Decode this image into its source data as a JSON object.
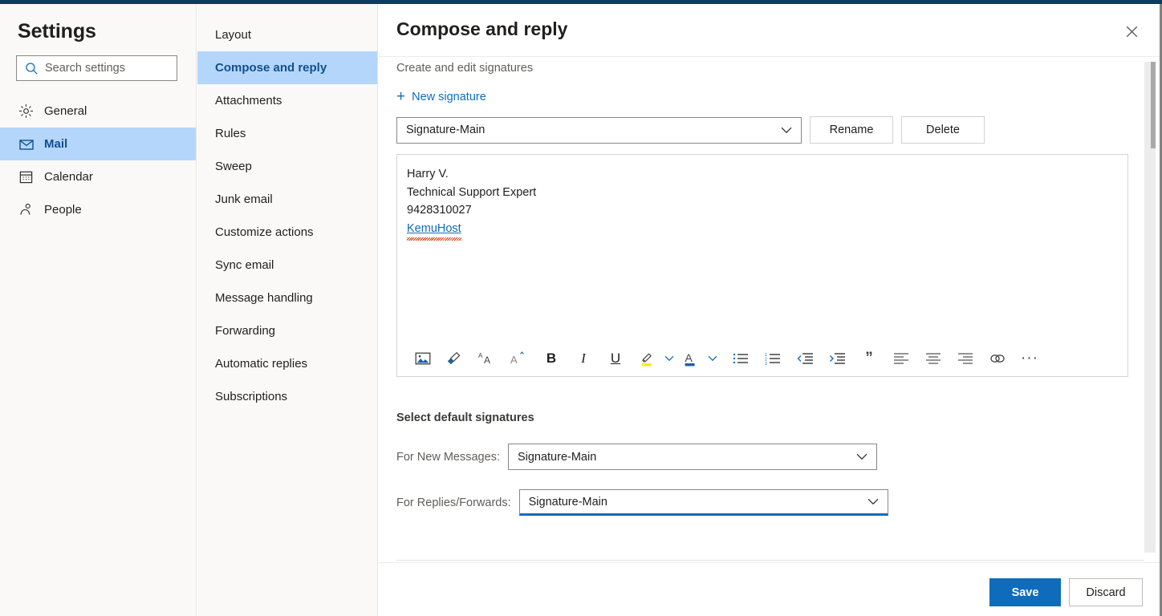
{
  "settings": {
    "title": "Settings",
    "search": {
      "placeholder": "Search settings",
      "value": "",
      "icon": "search-icon"
    },
    "categories": [
      {
        "label": "General",
        "icon": "gear-icon",
        "selected": false
      },
      {
        "label": "Mail",
        "icon": "envelope-icon",
        "selected": true
      },
      {
        "label": "Calendar",
        "icon": "calendar-icon",
        "selected": false
      },
      {
        "label": "People",
        "icon": "person-icon",
        "selected": false
      }
    ]
  },
  "subnav": {
    "items": [
      {
        "label": "Layout",
        "selected": false
      },
      {
        "label": "Compose and reply",
        "selected": true
      },
      {
        "label": "Attachments",
        "selected": false
      },
      {
        "label": "Rules",
        "selected": false
      },
      {
        "label": "Sweep",
        "selected": false
      },
      {
        "label": "Junk email",
        "selected": false
      },
      {
        "label": "Customize actions",
        "selected": false
      },
      {
        "label": "Sync email",
        "selected": false
      },
      {
        "label": "Message handling",
        "selected": false
      },
      {
        "label": "Forwarding",
        "selected": false
      },
      {
        "label": "Automatic replies",
        "selected": false
      },
      {
        "label": "Subscriptions",
        "selected": false
      }
    ]
  },
  "detail": {
    "title": "Compose and reply",
    "close_icon": "close-icon",
    "section_label": "Create and edit signatures",
    "new_signature_label": "New signature",
    "signature_select": {
      "value": "Signature-Main"
    },
    "rename_label": "Rename",
    "delete_label": "Delete",
    "signature_body": {
      "line1": "Harry V.",
      "line2": "Technical Support Expert",
      "line3": "9428310027",
      "link": "KemuHost"
    },
    "toolbar": [
      {
        "name": "insert-picture-icon",
        "type": "icon"
      },
      {
        "name": "format-painter-icon",
        "type": "icon"
      },
      {
        "name": "grow-font-icon",
        "type": "icon"
      },
      {
        "name": "shrink-font-icon",
        "type": "icon"
      },
      {
        "name": "bold-icon",
        "type": "text",
        "glyph": "B"
      },
      {
        "name": "italic-icon",
        "type": "text",
        "glyph": "I"
      },
      {
        "name": "underline-icon",
        "type": "text",
        "glyph": "U"
      },
      {
        "name": "highlight-color-icon",
        "type": "icon"
      },
      {
        "name": "highlight-chevron-down-icon",
        "type": "chev"
      },
      {
        "name": "font-color-icon",
        "type": "icon"
      },
      {
        "name": "font-color-chevron-down-icon",
        "type": "chev"
      },
      {
        "name": "bulleted-list-icon",
        "type": "icon"
      },
      {
        "name": "numbered-list-icon",
        "type": "icon"
      },
      {
        "name": "decrease-indent-icon",
        "type": "icon"
      },
      {
        "name": "increase-indent-icon",
        "type": "icon"
      },
      {
        "name": "quote-icon",
        "type": "text",
        "glyph": "”"
      },
      {
        "name": "align-left-icon",
        "type": "icon"
      },
      {
        "name": "align-center-icon",
        "type": "icon"
      },
      {
        "name": "align-right-icon",
        "type": "icon"
      },
      {
        "name": "insert-link-icon",
        "type": "icon"
      },
      {
        "name": "more-options-icon",
        "type": "text",
        "glyph": "···"
      }
    ],
    "defaults_label": "Select default signatures",
    "new_messages_label": "For New Messages:",
    "new_messages_value": "Signature-Main",
    "replies_label": "For Replies/Forwards:",
    "replies_value": "Signature-Main",
    "save_label": "Save",
    "discard_label": "Discard"
  },
  "colors": {
    "topbar": "#0f3b5f",
    "accent": "#0f6cbd",
    "selected_nav": "#b4d6fa",
    "selected_nav_text": "#12508f",
    "highlight_yellow": "#ffed00",
    "font_color_blue": "#1d5fa6",
    "spell_error": "#d83b01"
  }
}
